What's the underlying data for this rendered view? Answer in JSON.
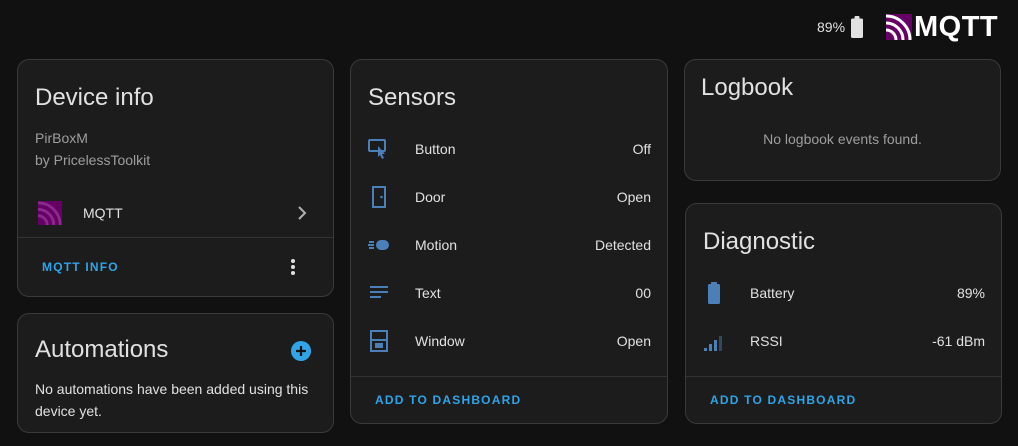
{
  "topbar": {
    "battery": "89%",
    "logo_text": "MQTT",
    "logo_icon": "mqtt-logo-icon",
    "battery_icon": "battery-icon"
  },
  "device_info": {
    "title": "Device info",
    "model": "PirBoxM",
    "manufacturer": "by PricelessToolkit",
    "integration": "MQTT",
    "action": "MQTT INFO"
  },
  "automations": {
    "title": "Automations",
    "message": "No automations have been added using this device yet."
  },
  "sensors": {
    "title": "Sensors",
    "items": [
      {
        "label": "Button",
        "value": "Off",
        "icon": "gesture-tap-button-icon"
      },
      {
        "label": "Door",
        "value": "Open",
        "icon": "door-icon"
      },
      {
        "label": "Motion",
        "value": "Detected",
        "icon": "motion-sensor-icon"
      },
      {
        "label": "Text",
        "value": "00",
        "icon": "text-icon"
      },
      {
        "label": "Window",
        "value": "Open",
        "icon": "window-open-icon"
      }
    ],
    "action": "ADD TO DASHBOARD"
  },
  "logbook": {
    "title": "Logbook",
    "message": "No logbook events found."
  },
  "diagnostic": {
    "title": "Diagnostic",
    "items": [
      {
        "label": "Battery",
        "value": "89%",
        "icon": "battery-icon"
      },
      {
        "label": "RSSI",
        "value": "-61 dBm",
        "icon": "signal-icon"
      }
    ],
    "action": "ADD TO DASHBOARD"
  },
  "colors": {
    "background": "#111111",
    "card": "#1c1c1c",
    "accent": "#2fa4e7",
    "icon": "#4b7fb8",
    "mqtt_purple": "#660066"
  }
}
